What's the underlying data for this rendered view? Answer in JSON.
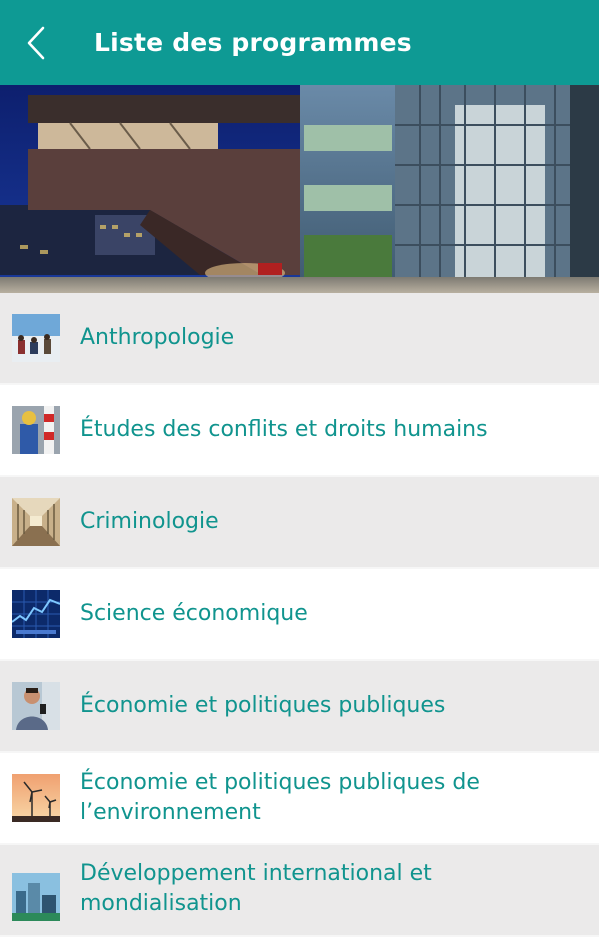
{
  "app_bar": {
    "title": "Liste des programmes",
    "back_icon": "chevron-left-icon"
  },
  "hero": {
    "description_icon": "building-photo"
  },
  "colors": {
    "accent": "#0e9a94",
    "label_text": "#10948e",
    "row_grey": "#ebeaea",
    "row_white": "#ffffff"
  },
  "programs": [
    {
      "label": "Anthropologie",
      "thumb": "snow-people-photo"
    },
    {
      "label": "Études des conflits et droits humains",
      "thumb": "protester-photo"
    },
    {
      "label": "Criminologie",
      "thumb": "corridor-photo"
    },
    {
      "label": "Science économique",
      "thumb": "stock-chart-photo"
    },
    {
      "label": "Économie et politiques publiques",
      "thumb": "person-phone-photo"
    },
    {
      "label": "Économie et politiques publiques de l’environnement",
      "thumb": "wind-turbine-photo"
    },
    {
      "label": "Développement international et mondialisation",
      "thumb": "city-photo"
    }
  ]
}
